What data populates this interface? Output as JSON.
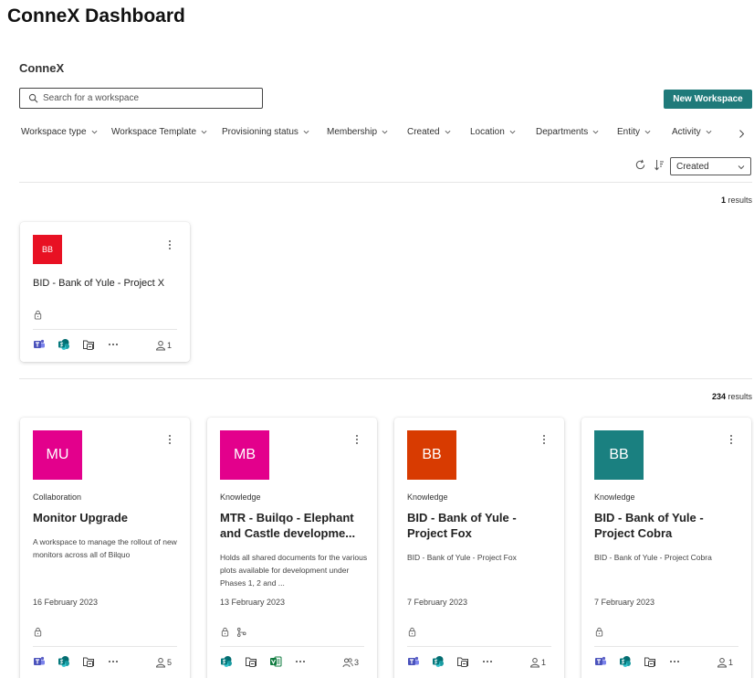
{
  "header": {
    "title": "ConneX Dashboard",
    "section": "ConneX"
  },
  "search": {
    "placeholder": "Search for a workspace"
  },
  "new_workspace_label": "New Workspace",
  "filters": [
    "Workspace type",
    "Workspace Template",
    "Provisioning status",
    "Membership",
    "Created",
    "Location",
    "Departments",
    "Entity",
    "Activity"
  ],
  "sort": {
    "selected": "Created"
  },
  "pinned": {
    "count": "1",
    "results_label": "results",
    "card": {
      "initials": "BB",
      "color": "#e81123",
      "name": "BID - Bank of Yule - Project X",
      "members": "1"
    }
  },
  "all": {
    "count": "234",
    "results_label": "results",
    "cards": [
      {
        "initials": "MU",
        "color": "#e3008c",
        "type": "Collaboration",
        "name": "Monitor Upgrade",
        "description": "A workspace to manage the rollout of new monitors across all of Bilquo",
        "date": "16 February 2023",
        "members": "5"
      },
      {
        "initials": "MB",
        "color": "#e3008c",
        "type": "Knowledge",
        "name": "MTR - Builqo - Elephant and Castle developme...",
        "description": "Holds all shared documents for the various plots available for development under Phases 1, 2 and ...",
        "date": "13 February 2023",
        "members": "3"
      },
      {
        "initials": "BB",
        "color": "#d83b01",
        "type": "Knowledge",
        "name": "BID - Bank of Yule - Project Fox",
        "description": "BID - Bank of Yule - Project Fox",
        "date": "7 February 2023",
        "members": "1"
      },
      {
        "initials": "BB",
        "color": "#1a8080",
        "type": "Knowledge",
        "name": "BID - Bank of Yule - Project Cobra",
        "description": "BID - Bank of Yule - Project Cobra",
        "date": "7 February 2023",
        "members": "1"
      }
    ]
  }
}
